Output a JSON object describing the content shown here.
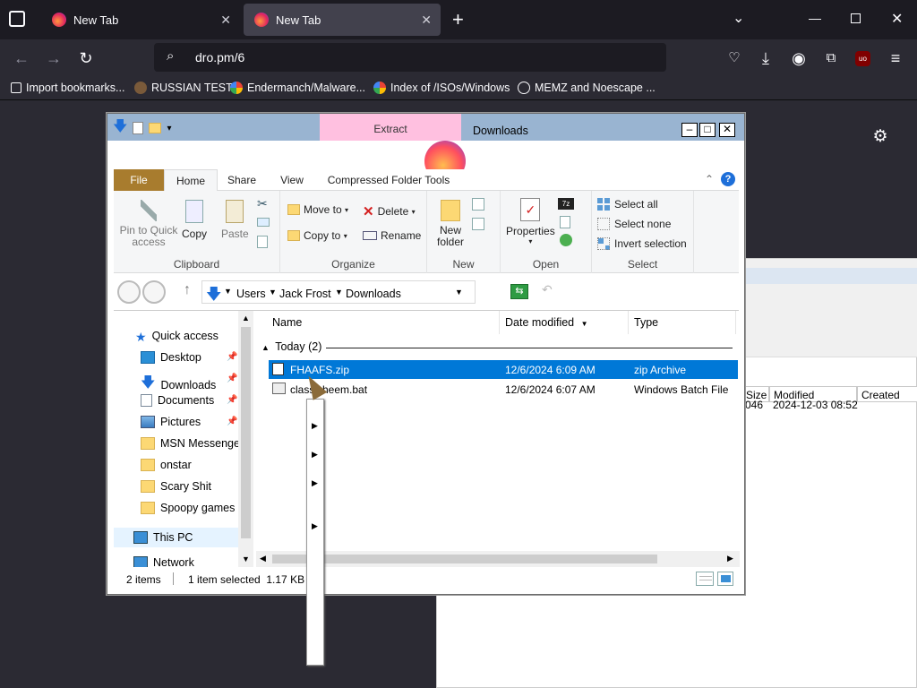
{
  "browser": {
    "tabs": [
      {
        "label": "New Tab",
        "active": false
      },
      {
        "label": "New Tab",
        "active": true
      }
    ],
    "new_tab": "+",
    "url": "dro.pm/6",
    "bookmarks": [
      {
        "label": "Import bookmarks...",
        "icon": "import-icon"
      },
      {
        "label": "RUSSIAN TEST",
        "icon": "site-icon"
      },
      {
        "label": "Endermanch/Malware...",
        "icon": "google-icon"
      },
      {
        "label": "Index of /ISOs/Windows",
        "icon": "google-icon"
      },
      {
        "label": "MEMZ and Noescape ...",
        "icon": "globe-icon"
      }
    ]
  },
  "background_window": {
    "columns": [
      "Size",
      "Modified",
      "Created"
    ],
    "row": {
      "size": "046",
      "modified": "2024-12-03 08:52"
    }
  },
  "explorer": {
    "title": "Downloads",
    "context_tab": "Extract",
    "banner_text": "Firefox",
    "ribbon_tabs": [
      "File",
      "Home",
      "Share",
      "View",
      "Compressed Folder Tools"
    ],
    "groups": {
      "clipboard": {
        "label": "Clipboard",
        "pin": "Pin to Quick access",
        "copy": "Copy",
        "paste": "Paste"
      },
      "organize": {
        "label": "Organize",
        "move_to": "Move to",
        "copy_to": "Copy to",
        "delete": "Delete",
        "rename": "Rename"
      },
      "new": {
        "label": "New",
        "new_folder": "New folder"
      },
      "open": {
        "label": "Open",
        "properties": "Properties"
      },
      "select": {
        "label": "Select",
        "select_all": "Select all",
        "select_none": "Select none",
        "invert": "Invert selection"
      }
    },
    "breadcrumb": [
      "Users",
      "Jack Frost",
      "Downloads"
    ],
    "nav": [
      {
        "label": "Quick access",
        "icon": "star-icon",
        "indent": 0
      },
      {
        "label": "Desktop",
        "icon": "desktop-icon",
        "indent": 1,
        "pinned": true
      },
      {
        "label": "Downloads",
        "icon": "download-icon",
        "indent": 1,
        "pinned": true
      },
      {
        "label": "Documents",
        "icon": "documents-icon",
        "indent": 1,
        "pinned": true
      },
      {
        "label": "Pictures",
        "icon": "pictures-icon",
        "indent": 1,
        "pinned": true
      },
      {
        "label": "MSN Messenger",
        "icon": "folder-icon",
        "indent": 1
      },
      {
        "label": "onstar",
        "icon": "folder-icon",
        "indent": 1
      },
      {
        "label": "Scary Shit",
        "icon": "folder-icon",
        "indent": 1
      },
      {
        "label": "Spoopy games",
        "icon": "folder-icon",
        "indent": 1
      },
      {
        "label": "This PC",
        "icon": "computer-icon",
        "indent": 0
      },
      {
        "label": "Network",
        "icon": "network-icon",
        "indent": 0
      }
    ],
    "columns": {
      "name": "Name",
      "date": "Date modified",
      "type": "Type"
    },
    "group_header": "Today (2)",
    "files": [
      {
        "name": "FHAAFS.zip",
        "date": "12/6/2024 6:09 AM",
        "type": "zip Archive",
        "selected": true
      },
      {
        "name": "classicheem.bat",
        "date": "12/6/2024 6:07 AM",
        "type": "Windows Batch File",
        "selected": false
      }
    ],
    "status": {
      "items": "2 items",
      "selected": "1 item selected  1.17 KB"
    }
  },
  "colors": {
    "accent": "#0078d7",
    "file_tab": "#a87c2e",
    "titlebar": "#99b4d1",
    "context_tab": "#ffc0e0"
  }
}
